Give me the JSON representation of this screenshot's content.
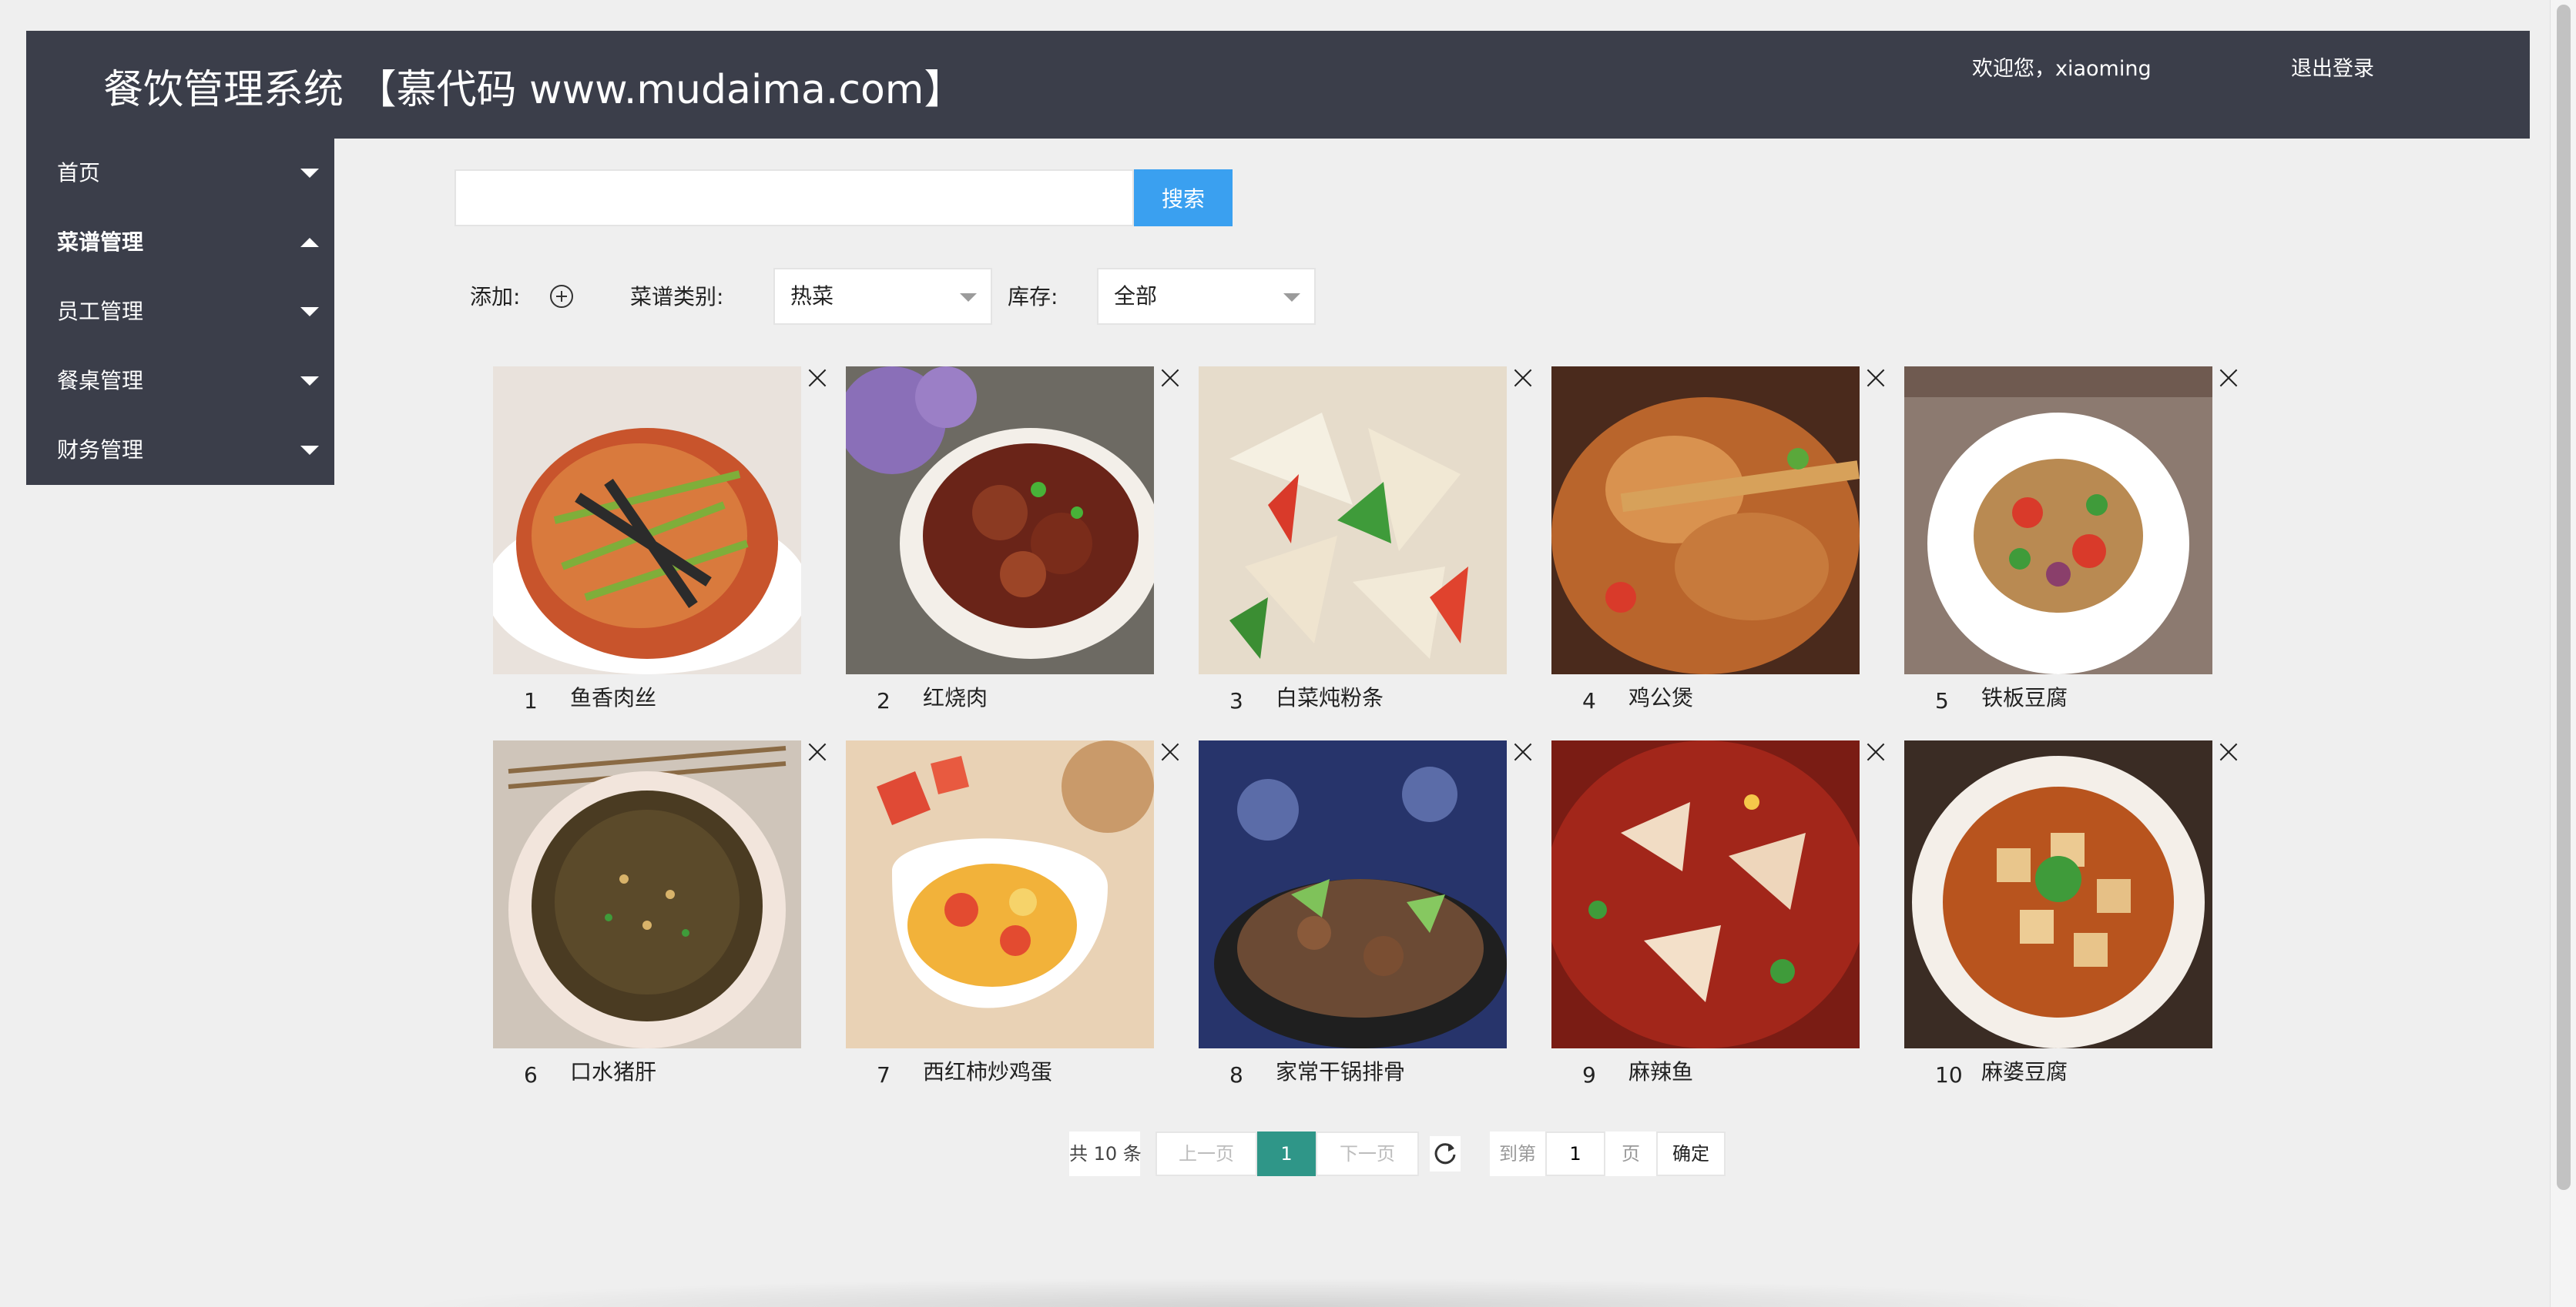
{
  "header": {
    "title": "餐饮管理系统 【慕代码 www.mudaima.com】",
    "welcome": "欢迎您，xiaoming",
    "logout": "退出登录"
  },
  "sidebar": {
    "items": [
      {
        "label": "首页",
        "state": "collapsed"
      },
      {
        "label": "菜谱管理",
        "state": "expanded"
      },
      {
        "label": "员工管理",
        "state": "collapsed"
      },
      {
        "label": "餐桌管理",
        "state": "collapsed"
      },
      {
        "label": "财务管理",
        "state": "collapsed"
      }
    ]
  },
  "search": {
    "value": "",
    "placeholder": "",
    "button_label": "搜索"
  },
  "filters": {
    "add_label": "添加:",
    "category_label": "菜谱类别:",
    "category_value": "热菜",
    "stock_label": "库存:",
    "stock_value": "全部"
  },
  "dishes": [
    {
      "num": "1",
      "name": "鱼香肉丝"
    },
    {
      "num": "2",
      "name": "红烧肉"
    },
    {
      "num": "3",
      "name": "白菜炖粉条"
    },
    {
      "num": "4",
      "name": "鸡公煲"
    },
    {
      "num": "5",
      "name": "铁板豆腐"
    },
    {
      "num": "6",
      "name": "口水猪肝"
    },
    {
      "num": "7",
      "name": "西红柿炒鸡蛋"
    },
    {
      "num": "8",
      "name": "家常干锅排骨"
    },
    {
      "num": "9",
      "name": "麻辣鱼"
    },
    {
      "num": "10",
      "name": "麻婆豆腐"
    }
  ],
  "pagination": {
    "total": "共 10 条",
    "prev": "上一页",
    "current": "1",
    "next": "下一页",
    "goto_label": "到第",
    "goto_value": "1",
    "page_label": "页",
    "confirm": "确定"
  },
  "colors": {
    "header_bg": "#3b3e4a",
    "search_button": "#3aa0f0",
    "pager_active": "#2f9688"
  }
}
